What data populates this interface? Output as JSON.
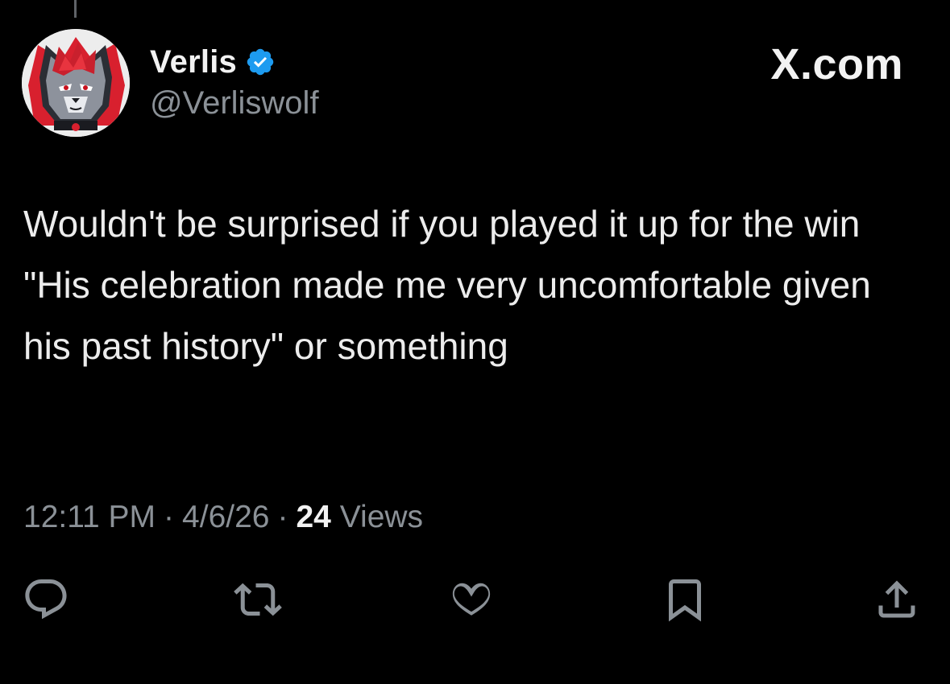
{
  "author": {
    "display_name": "Verlis",
    "handle": "@Verliswolf",
    "verified": true,
    "avatar_icon": "wolf-avatar"
  },
  "brand": {
    "text": "X.com"
  },
  "tweet": {
    "text": "Wouldn't be surprised if you played it up for the win \"His celebration made me very uncomfortable given his past history\" or something"
  },
  "meta": {
    "time": "12:11 PM",
    "separator": "·",
    "date": "4/6/26",
    "views_count": "24",
    "views_label": "Views"
  },
  "actions": [
    {
      "icon": "reply-icon"
    },
    {
      "icon": "retweet-icon"
    },
    {
      "icon": "like-icon"
    },
    {
      "icon": "bookmark-icon"
    },
    {
      "icon": "share-icon"
    }
  ],
  "colors": {
    "background": "#000000",
    "primary_text": "#e7e9ea",
    "secondary_text": "#8b9197",
    "verified_blue": "#1d9bf0",
    "avatar_accent_red": "#d8202e"
  }
}
